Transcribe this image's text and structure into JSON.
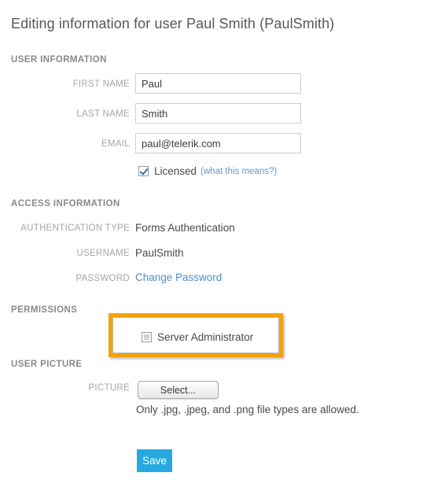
{
  "page": {
    "title": "Editing information for user Paul Smith (PaulSmith)"
  },
  "sections": {
    "user_information": {
      "heading": "USER INFORMATION",
      "fields": {
        "first_name": {
          "label": "FIRST NAME",
          "value": "Paul"
        },
        "last_name": {
          "label": "LAST NAME",
          "value": "Smith"
        },
        "email": {
          "label": "EMAIL",
          "value": "paul@telerik.com"
        }
      },
      "licensed": {
        "label": "Licensed",
        "hint": "(what this means?)",
        "checked": true
      }
    },
    "access_information": {
      "heading": "ACCESS INFORMATION",
      "fields": {
        "authentication_type": {
          "label": "AUTHENTICATION TYPE",
          "value": "Forms Authentication"
        },
        "username": {
          "label": "USERNAME",
          "value": "PaulSmith"
        },
        "password": {
          "label": "PASSWORD",
          "value": "Change Password"
        }
      }
    },
    "permissions": {
      "heading": "PERMISSIONS",
      "server_administrator": {
        "label": "Server Administrator",
        "checked": false
      },
      "highlight_color": "#f0a30a"
    },
    "user_picture": {
      "heading": "USER PICTURE",
      "picture_label": "PICTURE",
      "select_button": "Select...",
      "help_text": "Only .jpg, .jpeg, and .png file types are allowed."
    }
  },
  "actions": {
    "save_label": "Save",
    "save_color": "#26a9e0"
  }
}
